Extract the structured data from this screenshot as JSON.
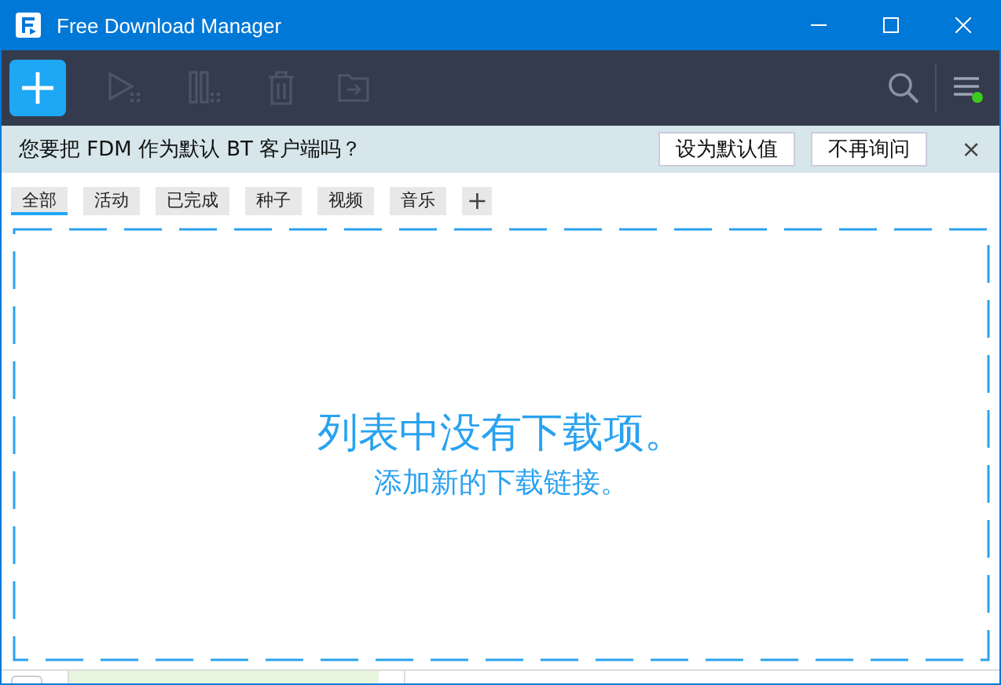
{
  "window": {
    "title": "Free Download Manager"
  },
  "toolbar": {
    "tools": [
      {
        "kind": "add",
        "disabled": false
      },
      {
        "kind": "play",
        "disabled": true
      },
      {
        "kind": "pause",
        "disabled": true
      },
      {
        "kind": "delete",
        "disabled": true
      },
      {
        "kind": "folder",
        "disabled": true
      }
    ],
    "menu_badge": true
  },
  "notification": {
    "message": "您要把 FDM 作为默认 BT 客户端吗？",
    "buttons": [
      "设为默认值",
      "不再询问"
    ],
    "close": "×"
  },
  "tabs": [
    {
      "label": "全部",
      "selected": true
    },
    {
      "label": "活动",
      "selected": false
    },
    {
      "label": "已完成",
      "selected": false
    },
    {
      "label": "种子",
      "selected": false
    },
    {
      "label": "视频",
      "selected": false
    },
    {
      "label": "音乐",
      "selected": false
    }
  ],
  "add_tab": "+",
  "empty": {
    "title": "列表中没有下载项。",
    "subtitle": "添加新的下载链接。"
  }
}
